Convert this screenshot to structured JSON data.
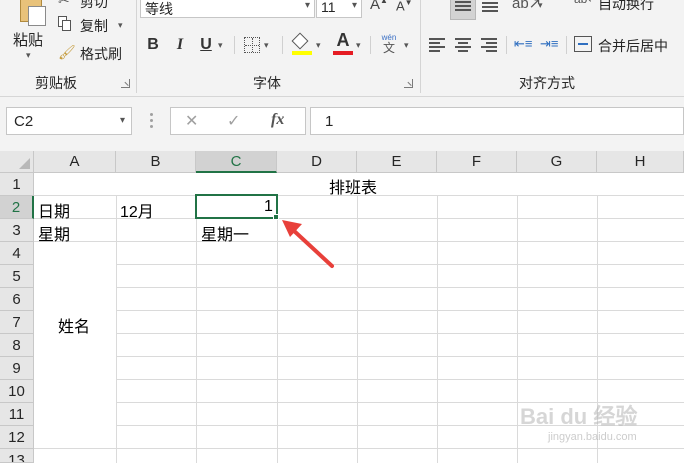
{
  "ribbon": {
    "clipboard": {
      "paste_label": "粘贴",
      "cut_label": "剪切",
      "copy_label": "复制",
      "format_painter_label": "格式刷",
      "group_label": "剪贴板"
    },
    "font": {
      "font_name": "等线",
      "font_size": "11",
      "font_color_glyph": "A",
      "phonetic_glyph": "wén",
      "group_label": "字体"
    },
    "alignment": {
      "wrap_text_label": "自动换行",
      "merge_center_label": "合并后居中",
      "group_label": "对齐方式"
    }
  },
  "formula_bar": {
    "name_box": "C2",
    "fx_label": "fx",
    "formula_value": "1"
  },
  "grid": {
    "columns": [
      "A",
      "B",
      "C",
      "D",
      "E",
      "F",
      "G",
      "H"
    ],
    "selected_column": "C",
    "rows": [
      "1",
      "2",
      "3",
      "4",
      "5",
      "6",
      "7",
      "8",
      "9",
      "10",
      "11",
      "12",
      "13"
    ],
    "selected_row": "2",
    "cells": {
      "D1": "排班表",
      "A2": "日期",
      "B2": "12月",
      "C2": "1",
      "A3": "星期",
      "C3": "星期一",
      "A4_merged": "姓名"
    },
    "active_cell": "C2",
    "accent_color": "#217346",
    "annotation_arrow_color": "#e8403a"
  },
  "watermark": {
    "text": "Bai du 经验",
    "sub": "jingyan.baidu.com"
  }
}
